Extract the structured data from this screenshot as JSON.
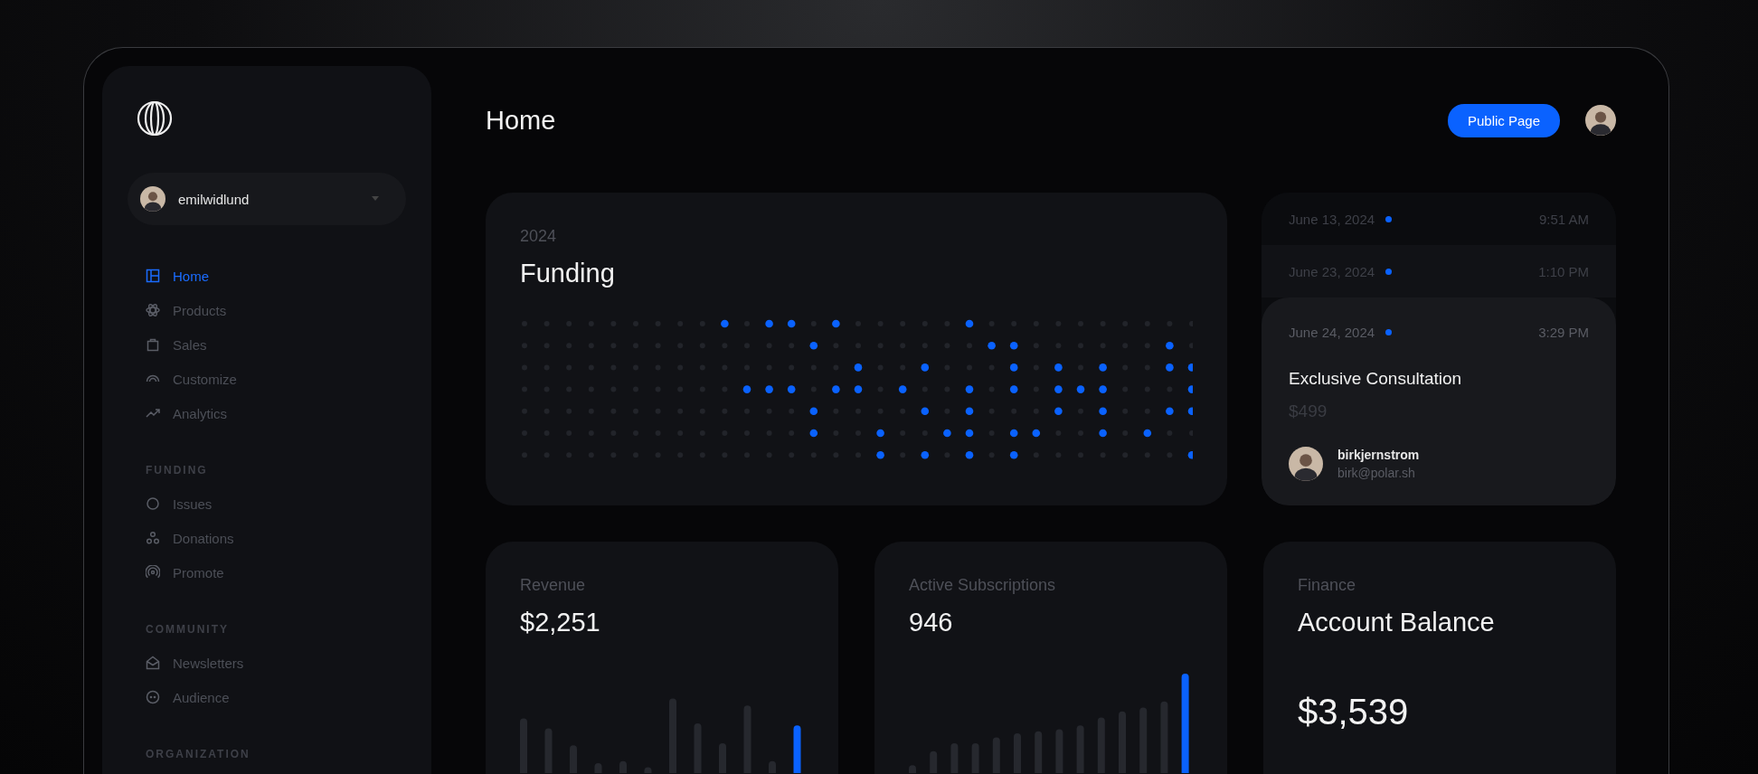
{
  "sidebar": {
    "user": "emilwidlund",
    "items": [
      {
        "label": "Home",
        "selected": true
      },
      {
        "label": "Products",
        "selected": false
      },
      {
        "label": "Sales",
        "selected": false
      },
      {
        "label": "Customize",
        "selected": false
      },
      {
        "label": "Analytics",
        "selected": false
      }
    ],
    "sections": [
      {
        "title": "FUNDING",
        "items": [
          {
            "label": "Issues",
            "selected": false
          },
          {
            "label": "Donations",
            "selected": false
          },
          {
            "label": "Promote",
            "selected": false
          }
        ]
      },
      {
        "title": "COMMUNITY",
        "items": [
          {
            "label": "Newsletters",
            "selected": false
          },
          {
            "label": "Audience",
            "selected": false
          }
        ]
      },
      {
        "title": "ORGANIZATION"
      }
    ]
  },
  "header": {
    "title": "Home",
    "button": "Public Page"
  },
  "funding": {
    "year": "2024",
    "title": "Funding"
  },
  "events": [
    {
      "date": "June 13, 2024",
      "time": "9:51 AM",
      "expanded": false
    },
    {
      "date": "June 23, 2024",
      "time": "1:10 PM",
      "expanded": false
    },
    {
      "date": "June 24, 2024",
      "time": "3:29 PM",
      "expanded": true,
      "title": "Exclusive Consultation",
      "price": "$499",
      "customer": "birkjernstrom",
      "email": "birk@polar.sh"
    }
  ],
  "revenue": {
    "label": "Revenue",
    "value": "$2,251"
  },
  "subscriptions": {
    "label": "Active Subscriptions",
    "value": "946"
  },
  "finance": {
    "label": "Finance",
    "title": "Account Balance",
    "value": "$3,539"
  }
}
